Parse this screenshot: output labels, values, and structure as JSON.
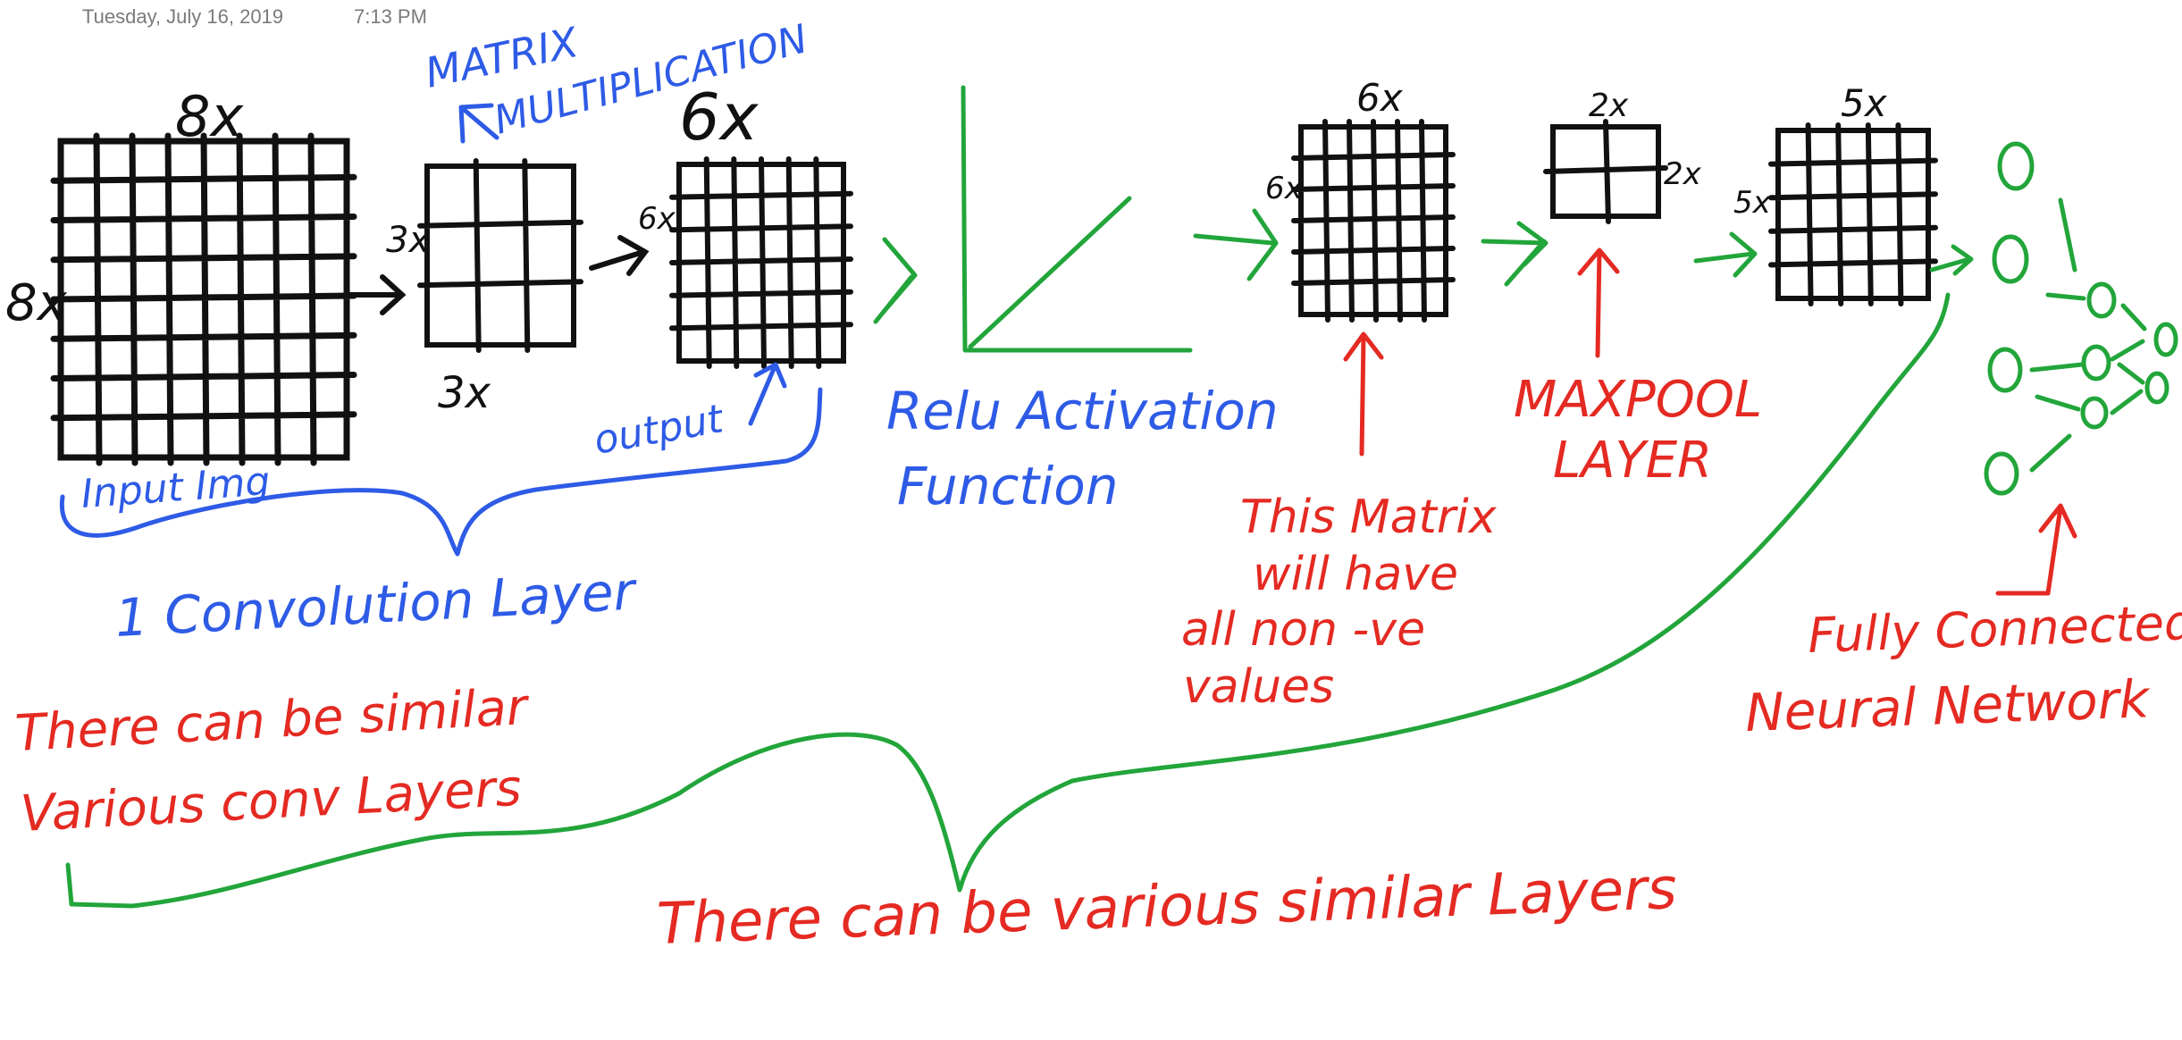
{
  "note": {
    "date": "Tuesday, July 16, 2019",
    "time": "7:13 PM"
  },
  "colors": {
    "ink": "#111111",
    "blue": "#2e5be6",
    "green": "#22a53a",
    "red": "#e42a22",
    "stamp": "#7a7a7a"
  },
  "labels": {
    "input_top": "8x",
    "input_side": "8x",
    "input_caption": "Input Img",
    "matrix_title_1": "MATRIX",
    "matrix_title_2": "MULTIPLICATION",
    "kernel_side": "3x",
    "kernel_bottom": "3x",
    "output_top": "6x",
    "output_side": "6x",
    "output_caption": "output",
    "conv_layer": "1 Convolution Layer",
    "similar_conv_1": "There can be similar",
    "similar_conv_2": "Various conv Layers",
    "relu_1": "Relu Activation",
    "relu_2": "Function",
    "relu_out_top": "6x",
    "relu_out_side": "6x",
    "nonneg_1": "This Matrix",
    "nonneg_2": "will have",
    "nonneg_3": "all non -ve",
    "nonneg_4": "values",
    "pool_top": "2x",
    "pool_side": "2x",
    "maxpool_1": "MAXPOOL",
    "maxpool_2": "LAYER",
    "final_top": "5x",
    "final_side": "5x",
    "fc_1": "Fully Connected",
    "fc_2": "Neural Network",
    "similar_layers": "There can be various similar Layers"
  }
}
